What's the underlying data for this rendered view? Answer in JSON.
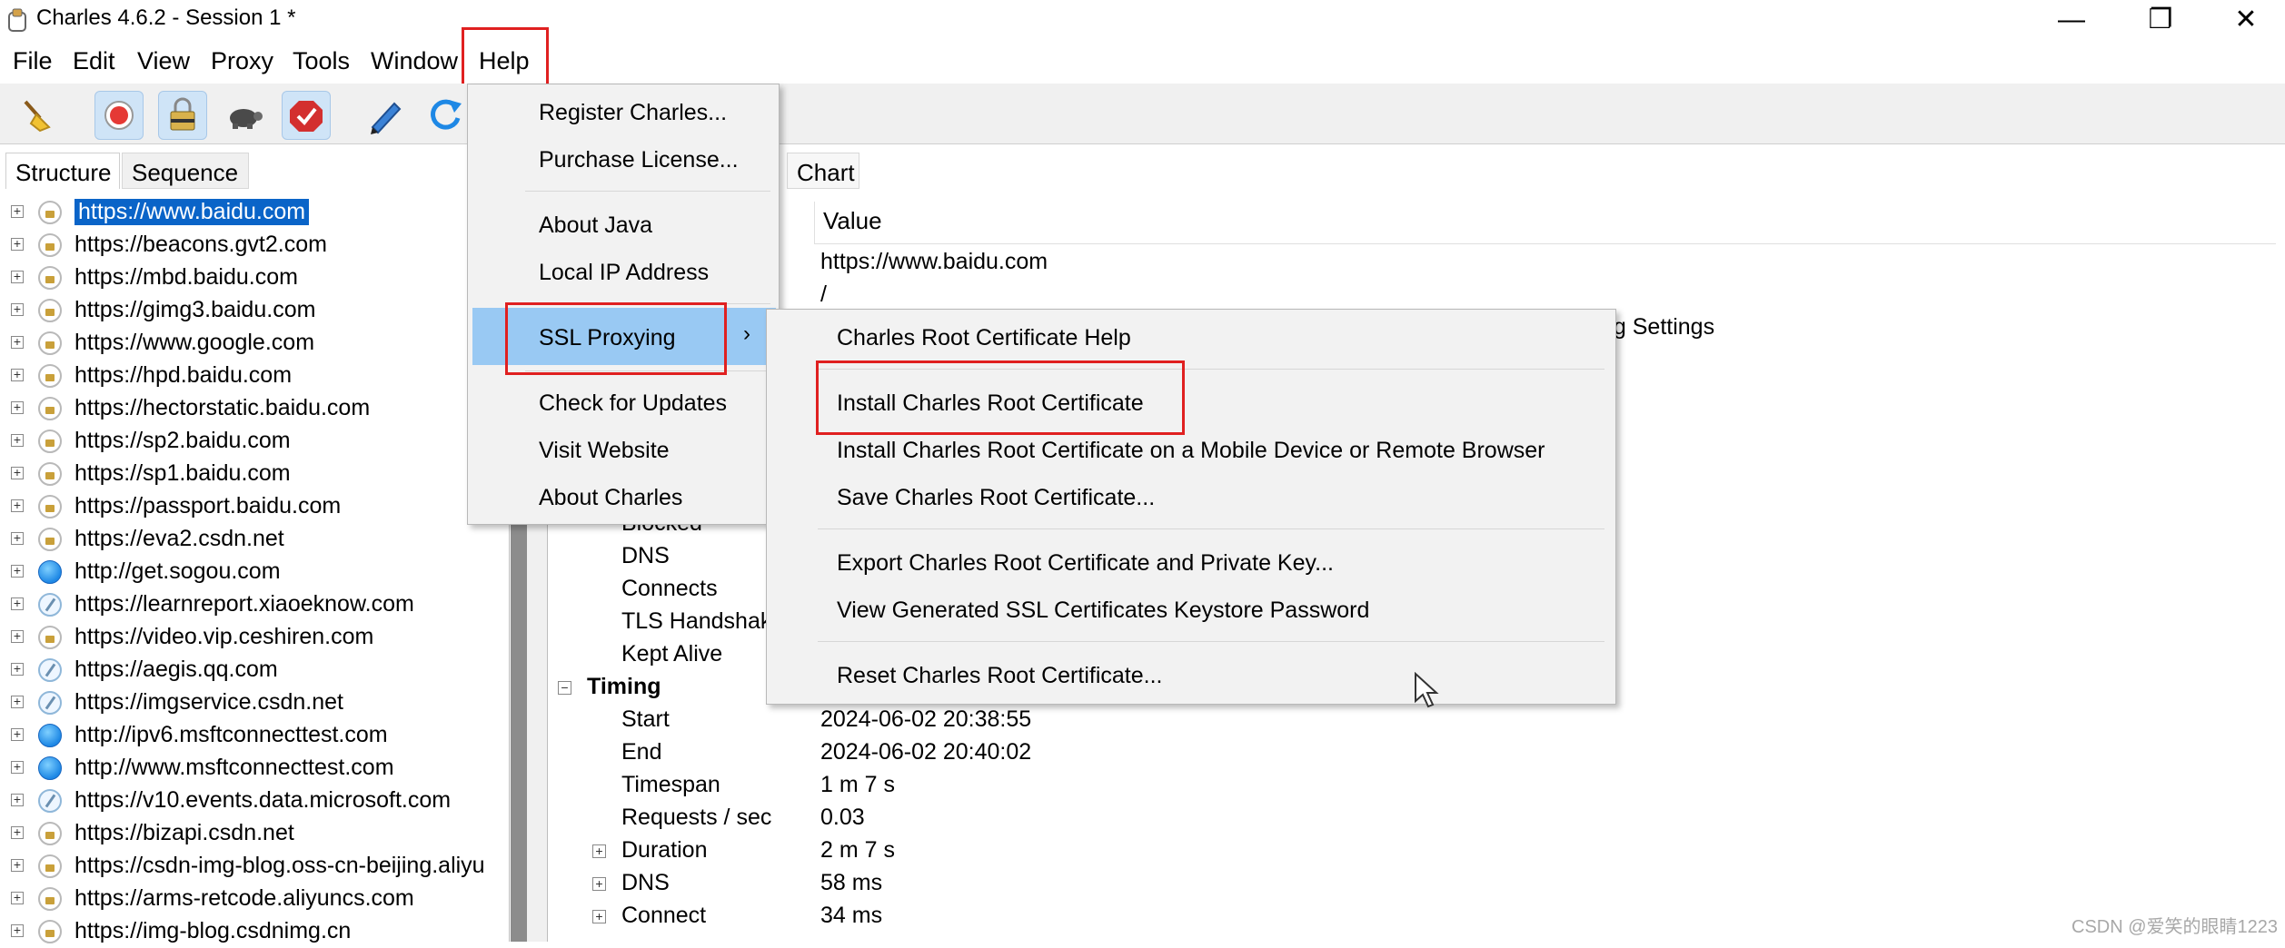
{
  "window": {
    "title": "Charles 4.6.2 - Session 1 *",
    "controls": {
      "minimize": "—",
      "maximize": "❐",
      "close": "✕"
    }
  },
  "menubar": [
    "File",
    "Edit",
    "View",
    "Proxy",
    "Tools",
    "Window",
    "Help"
  ],
  "toolbar": {
    "icons": [
      "broom-icon",
      "record-icon",
      "ssl-lock-icon",
      "throttle-turtle-icon",
      "breakpoint-icon",
      "compose-pen-icon",
      "refresh-icon"
    ]
  },
  "left_tabs": [
    "Structure",
    "Sequence"
  ],
  "hosts": [
    {
      "url": "https://www.baidu.com",
      "icon": "lock",
      "selected": true
    },
    {
      "url": "https://beacons.gvt2.com",
      "icon": "lock"
    },
    {
      "url": "https://mbd.baidu.com",
      "icon": "lock"
    },
    {
      "url": "https://gimg3.baidu.com",
      "icon": "lock"
    },
    {
      "url": "https://www.google.com",
      "icon": "lock"
    },
    {
      "url": "https://hpd.baidu.com",
      "icon": "lock"
    },
    {
      "url": "https://hectorstatic.baidu.com",
      "icon": "lock"
    },
    {
      "url": "https://sp2.baidu.com",
      "icon": "lock"
    },
    {
      "url": "https://sp1.baidu.com",
      "icon": "lock"
    },
    {
      "url": "https://passport.baidu.com",
      "icon": "lock"
    },
    {
      "url": "https://eva2.csdn.net",
      "icon": "lock"
    },
    {
      "url": "http://get.sogou.com",
      "icon": "globe"
    },
    {
      "url": "https://learnreport.xiaoeknow.com",
      "icon": "blocked"
    },
    {
      "url": "https://video.vip.ceshiren.com",
      "icon": "lock"
    },
    {
      "url": "https://aegis.qq.com",
      "icon": "blocked"
    },
    {
      "url": "https://imgservice.csdn.net",
      "icon": "blocked"
    },
    {
      "url": "http://ipv6.msftconnecttest.com",
      "icon": "globe"
    },
    {
      "url": "http://www.msftconnecttest.com",
      "icon": "globe"
    },
    {
      "url": "https://v10.events.data.microsoft.com",
      "icon": "blocked"
    },
    {
      "url": "https://bizapi.csdn.net",
      "icon": "lock"
    },
    {
      "url": "https://csdn-img-blog.oss-cn-beijing.aliyu",
      "icon": "lock"
    },
    {
      "url": "https://arms-retcode.aliyuncs.com",
      "icon": "lock"
    },
    {
      "url": "https://img-blog.csdnimg.cn",
      "icon": "lock"
    }
  ],
  "right": {
    "tab": "Chart",
    "column_header": "Value",
    "values_top": [
      "https://www.baidu.com",
      "/"
    ],
    "partial_value": "ng Settings",
    "labels_mid": [
      "Blocked",
      "DNS",
      "Connects",
      "TLS Handshak",
      "Kept Alive"
    ],
    "timing_section": "Timing",
    "timing_rows": [
      {
        "label": "Start",
        "value": "2024-06-02 20:38:55"
      },
      {
        "label": "End",
        "value": "2024-06-02 20:40:02"
      },
      {
        "label": "Timespan",
        "value": "1 m 7 s"
      },
      {
        "label": "Requests / sec",
        "value": "0.03"
      },
      {
        "label": "Duration",
        "value": "2 m 7 s"
      },
      {
        "label": "DNS",
        "value": "58 ms"
      },
      {
        "label": "Connect",
        "value": "34 ms"
      }
    ]
  },
  "help_menu": {
    "items": [
      "Register Charles...",
      "Purchase License...",
      "About Java",
      "Local IP Address",
      "SSL Proxying",
      "Check for Updates",
      "Visit Website",
      "About Charles"
    ]
  },
  "ssl_submenu": {
    "items": [
      "Charles Root Certificate Help",
      "Install Charles Root Certificate",
      "Install Charles Root Certificate on a Mobile Device or Remote Browser",
      "Save Charles Root Certificate...",
      "Export Charles Root Certificate and Private Key...",
      "View Generated SSL Certificates Keystore Password",
      "Reset Charles Root Certificate..."
    ]
  },
  "watermark": "CSDN @爱笑的眼睛1223",
  "colors": {
    "highlight": "#99c9f3",
    "selection": "#0a64c8",
    "annotation": "#e02020"
  }
}
